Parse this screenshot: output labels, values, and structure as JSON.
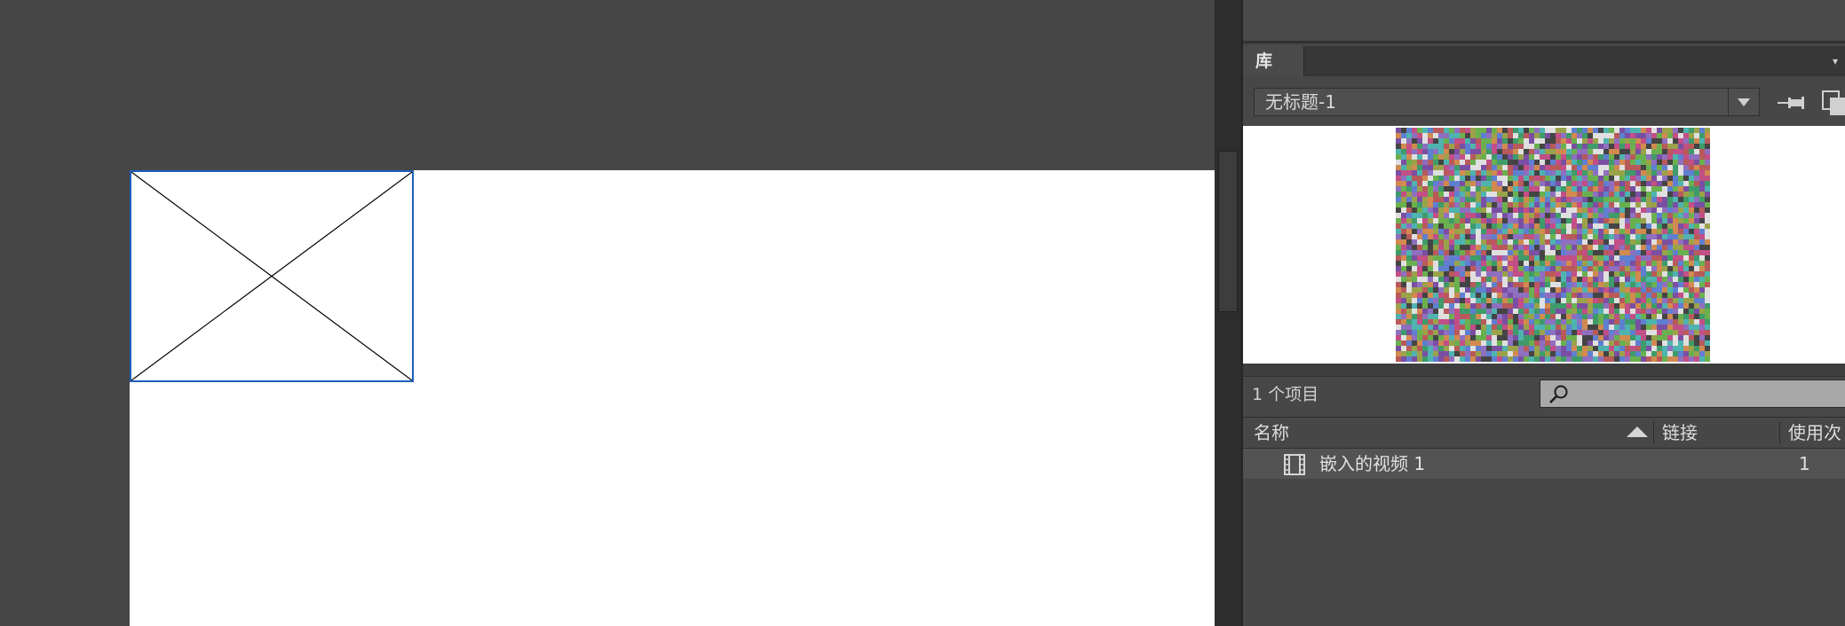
{
  "library_panel": {
    "tab_label": "库",
    "document_select": {
      "value": "无标题-1"
    },
    "item_count": "1 个项目",
    "search": {
      "placeholder": ""
    },
    "columns": {
      "name": "名称",
      "linkage": "链接",
      "use_count": "使用次"
    },
    "items": [
      {
        "name": "嵌入的视频 1",
        "linkage": "",
        "use_count": "1",
        "icon": "film-icon"
      }
    ]
  },
  "colors": {
    "workspace_bg": "#464646",
    "panel_bg": "#474747",
    "selection_outline": "#1f5fb8",
    "row_bg": "#535353"
  }
}
